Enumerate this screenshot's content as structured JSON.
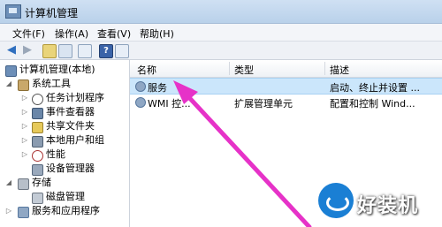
{
  "window": {
    "title": "计算机管理"
  },
  "menu": {
    "file": "文件(F)",
    "action": "操作(A)",
    "view": "查看(V)",
    "help": "帮助(H)"
  },
  "tree": {
    "root": "计算机管理(本地)",
    "system_tools": "系统工具",
    "task_scheduler": "任务计划程序",
    "event_viewer": "事件查看器",
    "shared_folders": "共享文件夹",
    "local_users": "本地用户和组",
    "performance": "性能",
    "device_manager": "设备管理器",
    "storage": "存储",
    "disk_management": "磁盘管理",
    "services_apps": "服务和应用程序"
  },
  "list": {
    "columns": {
      "name": "名称",
      "type": "类型",
      "description": "描述"
    },
    "rows": [
      {
        "name": "服务",
        "type": "",
        "description": "启动、终止并设置 ..."
      },
      {
        "name": "WMI 控...",
        "type": "扩展管理单元",
        "description": "配置和控制 Wind..."
      }
    ]
  },
  "watermark": {
    "text": "好装机"
  },
  "colors": {
    "arrow": "#e632c8",
    "selection": "#cbe6fb",
    "watermark_blue": "#1a7fd4"
  }
}
